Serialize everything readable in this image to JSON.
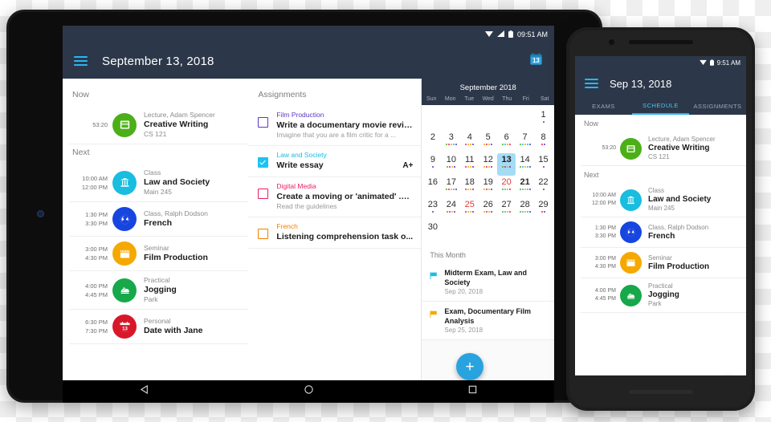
{
  "colors": {
    "appbar": "#2c3849",
    "accent": "#29b6f6",
    "fab": "#29a3e0",
    "selected_day": "#a5dcf5"
  },
  "tablet": {
    "status_bar": {
      "time": "09:51 AM",
      "icons": [
        "wifi-icon",
        "signal-icon",
        "battery-icon"
      ]
    },
    "appbar": {
      "menu_icon": "hamburger-menu-icon",
      "title": "September 13, 2018",
      "action_icon": "calendar-13-icon"
    },
    "schedule": {
      "now_label": "Now",
      "next_label": "Next",
      "now": [
        {
          "timer": "53:20",
          "subtitle": "Lecture, Adam Spencer",
          "title": "Creative Writing",
          "location": "CS 121",
          "icon": "book-icon",
          "color": "#4caf18"
        }
      ],
      "next": [
        {
          "start": "10:00 AM",
          "end": "12:00 PM",
          "subtitle": "Class",
          "title": "Law and Society",
          "location": "Main 245",
          "icon": "column-icon",
          "color": "#18bde0"
        },
        {
          "start": "1:30 PM",
          "end": "3:30 PM",
          "subtitle": "Class, Ralph Dodson",
          "title": "French",
          "location": "",
          "icon": "globe-icon",
          "color": "#1745e0"
        },
        {
          "start": "3:00 PM",
          "end": "4:30 PM",
          "subtitle": "Seminar",
          "title": "Film Production",
          "location": "",
          "icon": "clapper-icon",
          "color": "#f5a800"
        },
        {
          "start": "4:00 PM",
          "end": "4:45 PM",
          "subtitle": "Practical",
          "title": "Jogging",
          "location": "Park",
          "icon": "shoe-icon",
          "color": "#17a84a"
        },
        {
          "start": "6:30 PM",
          "end": "7:30 PM",
          "subtitle": "Personal",
          "title": "Date with Jane",
          "location": "",
          "icon": "calendar-13-icon",
          "color": "#d8182a"
        }
      ]
    },
    "assignments": {
      "header": "Assignments",
      "items": [
        {
          "course": "Film Production",
          "course_color": "#5c35c4",
          "title": "Write a documentary movie review",
          "desc": "Imagine that you are a film critic for a ...",
          "grade": "",
          "checked": false
        },
        {
          "course": "Law and Society",
          "course_color": "#18bde0",
          "title": "Write essay",
          "desc": "",
          "grade": "A+",
          "checked": true
        },
        {
          "course": "Digital Media",
          "course_color": "#e91e63",
          "title": "Create a moving or 'animated' .gi...",
          "desc": "Read the guidelines",
          "grade": "",
          "checked": false
        },
        {
          "course": "French",
          "course_color": "#f57c00",
          "title": "Listening comprehension task o...",
          "desc": "",
          "grade": "",
          "checked": false
        }
      ]
    },
    "calendar": {
      "month_title": "September 2018",
      "dow": [
        "Sun",
        "Mon",
        "Tue",
        "Wed",
        "Thu",
        "Fri",
        "Sat"
      ],
      "selected_day": 13,
      "red_days": [
        20,
        25
      ],
      "bold_days": [
        21
      ],
      "days": [
        {
          "n": null
        },
        {
          "n": null
        },
        {
          "n": null
        },
        {
          "n": null
        },
        {
          "n": null
        },
        {
          "n": null
        },
        {
          "n": 1,
          "dots": [
            "#5c35c4"
          ]
        },
        {
          "n": 2,
          "dots": []
        },
        {
          "n": 3,
          "dots": [
            "#4caf18",
            "#e91e63",
            "#f5a800",
            "#18bde0",
            "#5c35c4"
          ]
        },
        {
          "n": 4,
          "dots": [
            "#e91e63",
            "#f5a800",
            "#f5a800",
            "#5c35c4"
          ]
        },
        {
          "n": 5,
          "dots": [
            "#f5a800",
            "#e91e63",
            "#f5a800",
            "#5c35c4"
          ]
        },
        {
          "n": 6,
          "dots": [
            "#4caf18",
            "#18bde0",
            "#f5a800",
            "#e91e63"
          ]
        },
        {
          "n": 7,
          "dots": [
            "#4caf18",
            "#18bde0",
            "#f5a800",
            "#18bde0",
            "#5c35c4"
          ]
        },
        {
          "n": 8,
          "dots": [
            "#e91e63",
            "#5c35c4"
          ]
        },
        {
          "n": 9,
          "dots": [
            "#5c35c4"
          ]
        },
        {
          "n": 10,
          "dots": [
            "#4caf18",
            "#e91e63",
            "#f5a800",
            "#5c35c4"
          ]
        },
        {
          "n": 11,
          "dots": [
            "#e91e63",
            "#f5a800",
            "#f5a800",
            "#5c35c4"
          ]
        },
        {
          "n": 12,
          "dots": [
            "#f5a800",
            "#e91e63",
            "#f5a800",
            "#5c35c4"
          ]
        },
        {
          "n": 13,
          "dots": [
            "#4caf18",
            "#e91e63",
            "#f5a800",
            "#5c35c4"
          ]
        },
        {
          "n": 14,
          "dots": [
            "#4caf18",
            "#18bde0",
            "#f5a800",
            "#18bde0",
            "#5c35c4"
          ]
        },
        {
          "n": 15,
          "dots": [
            "#5c35c4"
          ]
        },
        {
          "n": 16,
          "dots": []
        },
        {
          "n": 17,
          "dots": [
            "#4caf18",
            "#e91e63",
            "#f5a800",
            "#18bde0",
            "#5c35c4"
          ]
        },
        {
          "n": 18,
          "dots": [
            "#e91e63",
            "#f5a800",
            "#f5a800",
            "#5c35c4"
          ]
        },
        {
          "n": 19,
          "dots": [
            "#f5a800",
            "#e91e63",
            "#f5a800",
            "#5c35c4"
          ]
        },
        {
          "n": 20,
          "dots": [
            "#4caf18",
            "#18bde0",
            "#f5a800",
            "#e91e63"
          ]
        },
        {
          "n": 21,
          "dots": [
            "#4caf18",
            "#18bde0",
            "#f5a800",
            "#18bde0",
            "#5c35c4"
          ]
        },
        {
          "n": 22,
          "dots": [
            "#5c35c4"
          ]
        },
        {
          "n": 23,
          "dots": [
            "#5c35c4"
          ]
        },
        {
          "n": 24,
          "dots": [
            "#4caf18",
            "#e91e63",
            "#f5a800",
            "#5c35c4"
          ]
        },
        {
          "n": 25,
          "dots": [
            "#e91e63",
            "#f5a800",
            "#f5a800",
            "#5c35c4"
          ]
        },
        {
          "n": 26,
          "dots": [
            "#f5a800",
            "#e91e63",
            "#f5a800",
            "#5c35c4"
          ]
        },
        {
          "n": 27,
          "dots": [
            "#4caf18",
            "#18bde0",
            "#f5a800",
            "#e91e63"
          ]
        },
        {
          "n": 28,
          "dots": [
            "#4caf18",
            "#18bde0",
            "#f5a800",
            "#18bde0",
            "#5c35c4"
          ]
        },
        {
          "n": 29,
          "dots": [
            "#e91e63",
            "#5c35c4"
          ]
        },
        {
          "n": 30,
          "dots": []
        }
      ],
      "this_month_label": "This Month",
      "this_month": [
        {
          "title": "Midterm Exam, Law and Society",
          "date": "Sep 20, 2018",
          "flag_color": "#18bde0"
        },
        {
          "title": "Exam, Documentary Film Analysis",
          "date": "Sep 25, 2018",
          "flag_color": "#f5a800"
        }
      ]
    },
    "fab": {
      "label": "+",
      "icon": "plus-icon"
    },
    "navbar": {
      "back": "back-triangle-icon",
      "home": "home-circle-icon",
      "recents": "recents-square-icon"
    }
  },
  "phone": {
    "status_bar": {
      "time": "9:51 AM",
      "icons": [
        "wifi-icon",
        "battery-icon"
      ]
    },
    "appbar": {
      "menu_icon": "hamburger-menu-icon",
      "title": "Sep 13, 2018"
    },
    "tabs": [
      {
        "label": "EXAMS",
        "active": false
      },
      {
        "label": "SCHEDULE",
        "active": true
      },
      {
        "label": "ASSIGNMENTS",
        "active": false
      }
    ],
    "schedule": {
      "now_label": "Now",
      "next_label": "Next",
      "now": [
        {
          "timer": "53:20",
          "subtitle": "Lecture, Adam Spencer",
          "title": "Creative Writing",
          "location": "CS 121",
          "icon": "book-icon",
          "color": "#4caf18"
        }
      ],
      "next": [
        {
          "start": "10:00 AM",
          "end": "12:00 PM",
          "subtitle": "Class",
          "title": "Law and Society",
          "location": "Main 245",
          "icon": "column-icon",
          "color": "#18bde0"
        },
        {
          "start": "1:30 PM",
          "end": "3:30 PM",
          "subtitle": "Class, Ralph Dodson",
          "title": "French",
          "location": "",
          "icon": "globe-icon",
          "color": "#1745e0"
        },
        {
          "start": "3:00 PM",
          "end": "4:30 PM",
          "subtitle": "Seminar",
          "title": "Film Production",
          "location": "",
          "icon": "clapper-icon",
          "color": "#f5a800"
        },
        {
          "start": "4:00 PM",
          "end": "4:45 PM",
          "subtitle": "Practical",
          "title": "Jogging",
          "location": "Park",
          "icon": "shoe-icon",
          "color": "#17a84a"
        }
      ]
    },
    "fab": {
      "label": "+",
      "icon": "plus-icon"
    }
  }
}
